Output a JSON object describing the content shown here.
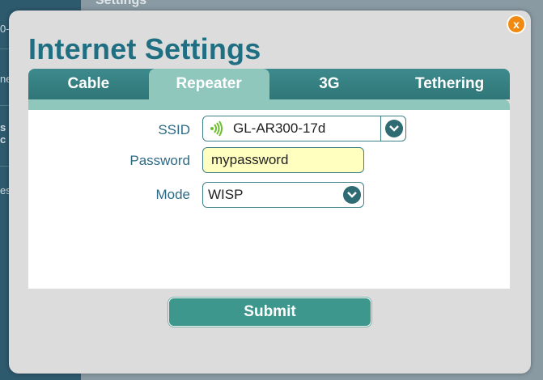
{
  "background": {
    "top_label": "Settings",
    "sidebar_fragments": [
      "0-",
      "ne",
      "s",
      "c",
      "es"
    ]
  },
  "dialog": {
    "title": "Internet Settings",
    "close_label": "x",
    "tabs": [
      {
        "label": "Cable",
        "active": false
      },
      {
        "label": "Repeater",
        "active": true
      },
      {
        "label": "3G",
        "active": false
      },
      {
        "label": "Tethering",
        "active": false
      }
    ],
    "form": {
      "ssid_label": "SSID",
      "ssid_value": "GL-AR300-17d",
      "password_label": "Password",
      "password_value": "mypassword",
      "mode_label": "Mode",
      "mode_value": "WISP"
    },
    "submit_label": "Submit"
  },
  "colors": {
    "title": "#1f6e82",
    "tab_bar": "#2f7678",
    "tab_active": "#8fc7bd",
    "submit": "#3d978c",
    "close": "#f08a12",
    "password_field_bg": "#ffffc0",
    "wifi_signal": "#6cbf2c"
  },
  "icons": {
    "ssid_signal": "wifi-signal-icon",
    "dropdown": "chevron-down-icon"
  }
}
